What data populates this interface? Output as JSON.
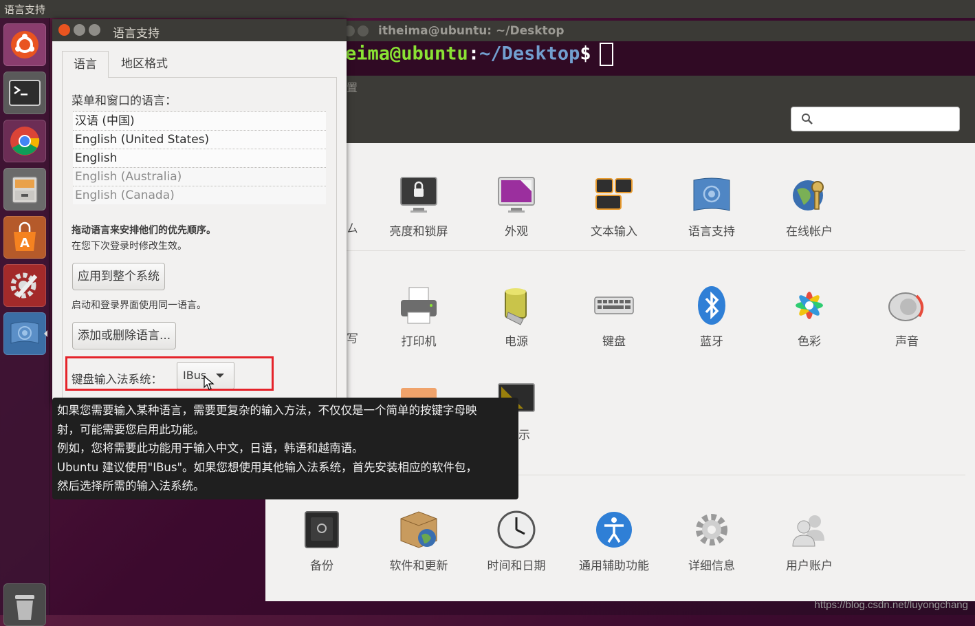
{
  "top_panel": {
    "app_title": "语言支持"
  },
  "terminal": {
    "title": "itheima@ubuntu: ~/Desktop",
    "prompt_user": "eima@ubuntu",
    "prompt_sep": ":",
    "prompt_path": "~/Desktop",
    "prompt_dollar": "$"
  },
  "settings": {
    "header_title_fragment": "置",
    "row1": [
      "亮度和锁屏",
      "外观",
      "文本输入",
      "语言支持",
      "在线帐户"
    ],
    "row1_partial": "ㄙ",
    "row2": [
      "打印机",
      "电源",
      "键盘",
      "蓝牙",
      "色彩",
      "声音"
    ],
    "row2_partial": "写",
    "row3_partial": "示",
    "row4": [
      "备份",
      "软件和更新",
      "时间和日期",
      "通用辅助功能",
      "详细信息",
      "用户账户"
    ]
  },
  "dialog": {
    "title": "语言支持",
    "tabs": [
      "语言",
      "地区格式"
    ],
    "menu_lang_label": "菜单和窗口的语言：",
    "languages": [
      {
        "name": "汉语 (中国)",
        "enabled": true
      },
      {
        "name": "English (United States)",
        "enabled": true
      },
      {
        "name": "English",
        "enabled": true
      },
      {
        "name": "English (Australia)",
        "enabled": false
      },
      {
        "name": "English (Canada)",
        "enabled": false
      }
    ],
    "drag_hint": "拖动语言来安排他们的优先顺序。",
    "next_login_hint": "在您下次登录时修改生效。",
    "apply_system_button": "应用到整个系统",
    "login_screen_hint": "启动和登录界面使用同一语言。",
    "add_remove_button": "添加或删除语言...",
    "keyboard_input_label": "键盘输入法系统：",
    "keyboard_input_value": "IBus"
  },
  "tooltip": {
    "lines": [
      "如果您需要输入某种语言，需要更复杂的输入方法，不仅仅是一个简单的按键字母映",
      "射，可能需要您启用此功能。",
      "例如，您将需要此功能用于输入中文，日语，韩语和越南语。",
      "Ubuntu 建议使用\"IBus\"。如果您想使用其他输入法系统，首先安装相应的软件包，",
      "然后选择所需的输入法系统。"
    ]
  },
  "watermark": "https://blog.csdn.net/luyongchang",
  "colors": {
    "highlight": "#e5232a",
    "panel": "#3c3b37",
    "terminal_bg": "#300a24",
    "prompt_user": "#8ae234",
    "prompt_path": "#729fcf"
  }
}
